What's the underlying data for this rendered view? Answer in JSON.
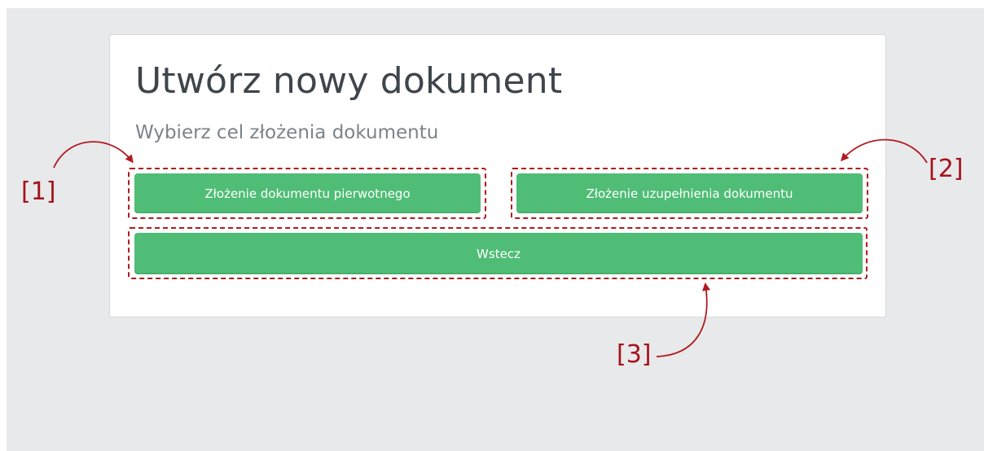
{
  "page": {
    "title": "Utwórz nowy dokument",
    "subtitle": "Wybierz cel złożenia dokumentu"
  },
  "buttons": {
    "primary_document": "Złożenie dokumentu pierwotnego",
    "supplement_document": "Złożenie uzupełnienia dokumentu",
    "back": "Wstecz"
  },
  "annotations": {
    "marker_1": "[1]",
    "marker_2": "[2]",
    "marker_3": "[3]"
  },
  "colors": {
    "button_green": "#4fbd76",
    "annotation_red": "#b01a1f",
    "backdrop": "#e8e9eb"
  }
}
